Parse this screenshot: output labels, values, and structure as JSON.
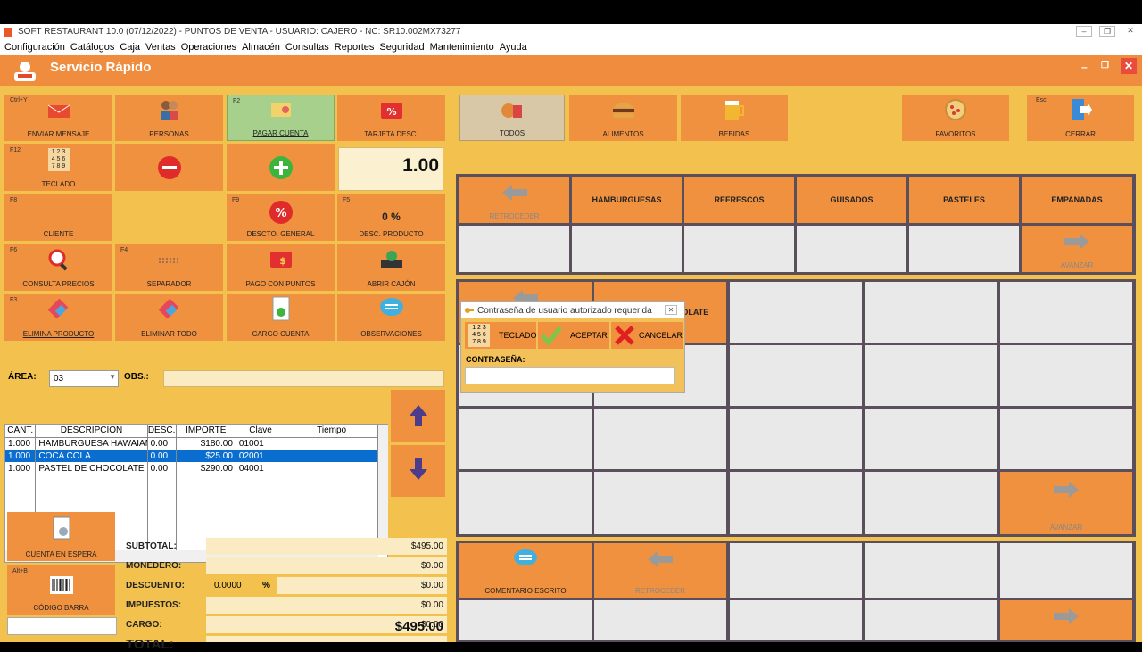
{
  "window": {
    "title": "SOFT RESTAURANT 10.0 (07/12/2022) - PUNTOS DE VENTA - USUARIO: CAJERO -   NC: SR10.002MX73277"
  },
  "menu": [
    "Configuración",
    "Catálogos",
    "Caja",
    "Ventas",
    "Operaciones",
    "Almacén",
    "Consultas",
    "Reportes",
    "Seguridad",
    "Mantenimiento",
    "Ayuda"
  ],
  "header": {
    "title": "Servicio Rápido",
    "min": "–",
    "restore": "❐",
    "close": "✕"
  },
  "tools": {
    "enviar": {
      "key": "Ctrl+Y",
      "label": "ENVIAR MENSAJE"
    },
    "personas": {
      "label": "PERSONAS"
    },
    "pagar": {
      "key": "F2",
      "label": "PAGAR CUENTA"
    },
    "tarjeta": {
      "label": "TARJETA DESC."
    },
    "teclado": {
      "key": "F12",
      "label": "TECLADO",
      "digits": "1 2 3\n4 5 6\n7 8 9"
    },
    "qty": "1.00",
    "cliente": {
      "key": "F8",
      "label": "CLIENTE"
    },
    "descto": {
      "key": "F9",
      "label": "DESCTO. GENERAL"
    },
    "descprod": {
      "key": "F5",
      "label": "DESC. PRODUCTO",
      "value": "0 %"
    },
    "consulta": {
      "key": "F6",
      "label": "CONSULTA PRECIOS"
    },
    "separador": {
      "key": "F4",
      "label": "SEPARADOR"
    },
    "pagopuntos": {
      "label": "PAGO CON PUNTOS"
    },
    "abrircajon": {
      "label": "ABRIR CAJÓN"
    },
    "elimina": {
      "key": "F3",
      "label": "ELIMINA PRODUCTO"
    },
    "eliminatodo": {
      "label": "ELIMINAR TODO"
    },
    "cargo": {
      "label": "CARGO CUENTA"
    },
    "observ": {
      "label": "OBSERVACIONES"
    }
  },
  "area": {
    "label": "ÁREA:",
    "value": "03",
    "obs_label": "OBS.:"
  },
  "order": {
    "headers": [
      "CANT.",
      "DESCRIPCIÓN",
      "DESC.",
      "IMPORTE",
      "Clave",
      "Tiempo"
    ],
    "rows": [
      [
        "1.000",
        "HAMBURGUESA HAWAIANA",
        "0.00",
        "$180.00",
        "01001",
        ""
      ],
      [
        "1.000",
        "COCA COLA",
        "0.00",
        "$25.00",
        "02001",
        ""
      ],
      [
        "1.000",
        "PASTEL DE CHOCOLATE",
        "0.00",
        "$290.00",
        "04001",
        ""
      ]
    ]
  },
  "totals": {
    "subtotal_label": "SUBTOTAL:",
    "subtotal": "$495.00",
    "monedero_label": "MONEDERO:",
    "monedero": "$0.00",
    "descuento_label": "DESCUENTO:",
    "descuento_pct": "0.0000",
    "pct": "%",
    "descuento": "$0.00",
    "impuestos_label": "IMPUESTOS:",
    "impuestos": "$0.00",
    "cargo_label": "CARGO:",
    "cargo": "$0.00",
    "total_label": "TOTAL:",
    "total": "$495.00"
  },
  "bottom": {
    "espera": "CUENTA EN ESPERA",
    "barra_key": "Alt+B",
    "barra": "CÓDIGO BARRA"
  },
  "topnav": {
    "todos": "TODOS",
    "alimentos": "ALIMENTOS",
    "bebidas": "BEBIDAS",
    "favoritos": "FAVORITOS",
    "cerrar_key": "Esc",
    "cerrar": "CERRAR"
  },
  "categories": {
    "back": "RETROCEDER",
    "items": [
      "HAMBURGUESAS",
      "REFRESCOS",
      "GUISADOS",
      "PASTELES",
      "EMPANADAS"
    ],
    "next": "AVANZAR"
  },
  "products": {
    "back": "",
    "item": "PASTEL DE CHOCOLATE",
    "next": "AVANZAR"
  },
  "modifiers": {
    "comment": "COMENTARIO ESCRITO",
    "back": "RETROCEDER",
    "next": "AVANZAR"
  },
  "dialog": {
    "title": "Contraseña de usuario autorizado requerida",
    "teclado": "TECLADO",
    "aceptar": "ACEPTAR",
    "cancelar": "CANCELAR",
    "pw_label": "CONTRASEÑA:",
    "pw_value": ""
  }
}
